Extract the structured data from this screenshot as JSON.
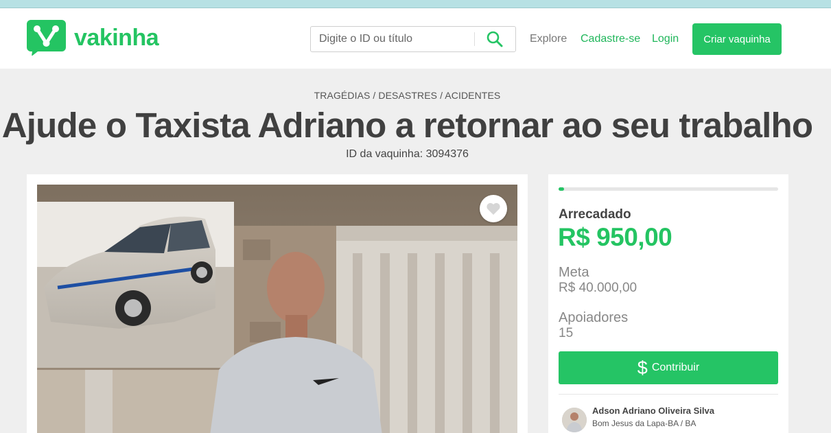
{
  "brand": {
    "name": "vakinha",
    "accent": "#25c465"
  },
  "search": {
    "placeholder": "Digite o ID ou título"
  },
  "nav": {
    "explore": "Explore",
    "signup": "Cadastre-se",
    "login": "Login",
    "create": "Criar vaquinha"
  },
  "campaign": {
    "category": "TRAGÉDIAS / DESASTRES / ACIDENTES",
    "title": "Ajude o Taxista Adriano a retornar ao seu trabalho",
    "id_label": "ID da vaquinha: 3094376",
    "progress_fraction": 0.024
  },
  "stats": {
    "raised_label": "Arrecadado",
    "raised_value": "R$ 950,00",
    "goal_label": "Meta",
    "goal_value": "R$ 40.000,00",
    "supporters_label": "Apoiadores",
    "supporters_value": "15",
    "contribute": "Contribuir"
  },
  "owner": {
    "name": "Adson Adriano Oliveira Silva",
    "location": "Bom Jesus da Lapa-BA / BA"
  }
}
